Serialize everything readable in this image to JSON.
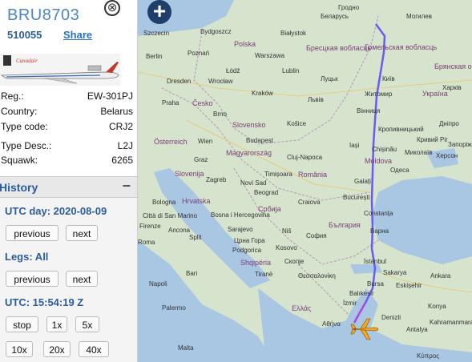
{
  "aircraft": {
    "callsign": "BRU8703",
    "hex": "510055",
    "share_label": "Share",
    "close_symbol": "⊗",
    "photo_text": "Canadair",
    "details": [
      {
        "label": "Reg.:",
        "value": "EW-301PJ"
      },
      {
        "label": "Country:",
        "value": "Belarus"
      },
      {
        "label": "Type code:",
        "value": "CRJ2"
      },
      {
        "label": "Type Desc.:",
        "value": "L2J"
      },
      {
        "label": "Squawk:",
        "value": "6265"
      }
    ]
  },
  "history": {
    "title": "History",
    "collapse_symbol": "−",
    "utc_day_label": "UTC day: 2020-08-09",
    "day_buttons": [
      "previous",
      "next"
    ],
    "legs_label": "Legs: All",
    "leg_buttons": [
      "previous",
      "next"
    ],
    "utc_time_label": "UTC: 15:54:19 Z",
    "speed_buttons_row1": [
      "stop",
      "1x",
      "5x"
    ],
    "speed_buttons_row2": [
      "10x",
      "20x",
      "40x"
    ]
  },
  "map": {
    "zoom_symbol": "+",
    "track_color": "#6a5cf0",
    "track_color_end": "#b04ae0",
    "aircraft_color": "#f5a623",
    "labels": {
      "belarus": "Беларусь",
      "mogilev": "Могилев",
      "bialystok": "Białystok",
      "grodno": "Гродно",
      "szczecin": "Szczecin",
      "bydgoszcz": "Bydgoszcz",
      "polska": "Polska",
      "warszawa": "Warszawa",
      "berlin": "Berlin",
      "poznan": "Poznań",
      "lodz": "Łódź",
      "lublin": "Lublin",
      "lutsk": "Луцьк",
      "kyiv": "Київ",
      "zhytomyr": "Житомир",
      "dresden": "Dresden",
      "wroclaw": "Wrocław",
      "praha": "Praha",
      "cesko": "Česko",
      "krakow": "Kraków",
      "lviv": "Львів",
      "vinnytsia": "Вінниця",
      "ukraina": "Україна",
      "kropyvnytskyi": "Кропивницький",
      "dnipro": "Дніпро",
      "kharkiv": "Харків",
      "zaporizhzhia": "Запоріжжя",
      "kryvyi_rih": "Кривий Ріг",
      "brno": "Brno",
      "slovensko": "Slovensko",
      "kosice": "Košice",
      "wien": "Wien",
      "osterreich": "Österreich",
      "budapest": "Budapest",
      "magyarorszag": "Magyarország",
      "chisinau": "Chișinău",
      "moldova": "Moldova",
      "odesa": "Одеса",
      "mykolaiv": "Миколаїв",
      "kherson": "Херсон",
      "cluj": "Cluj-Napoca",
      "romania": "România",
      "iasi": "Iași",
      "galati": "Galați",
      "graz": "Graz",
      "slovenija": "Slovenija",
      "zagreb": "Zagreb",
      "timisoara": "Timișoara",
      "novisad": "Novi Sad",
      "bucuresti": "București",
      "constanta": "Constanța",
      "beograd": "Beograd",
      "hrvatska": "Hrvatska",
      "bih": "Bosna i Hercegovina",
      "srbija": "Србија",
      "craiova": "Craiova",
      "bologna": "Bologna",
      "firenze": "Firenze",
      "sarajevo": "Sarajevo",
      "split": "Split",
      "nis": "Niš",
      "sofia": "София",
      "bulgaria": "България",
      "varna": "Варна",
      "crnagora": "Црна Гора",
      "podgorica": "Podgorica",
      "kosovo": "Kosovo",
      "shqiperia": "Shqipëria",
      "tirane": "Tiranë",
      "skopje": "Скопје",
      "roma": "Roma",
      "bari": "Bari",
      "napoli": "Napoli",
      "thessaloniki": "Θεσσαλονίκη",
      "istanbul": "İstanbul",
      "sakarya": "Sakarya",
      "ankara": "Ankara",
      "bursa": "Bursa",
      "eskisehir": "Eskişehir",
      "ellas": "Ελλάς",
      "izmir": "İzmir",
      "balikesir": "Balıkesir",
      "athina": "Αθήνα",
      "denizli": "Denizli",
      "antalya": "Antalya",
      "konya": "Konya",
      "kahramanmaras": "Kahramanmaraş",
      "palermo": "Palermo",
      "malta": "Malta",
      "kypros": "Κύπρος",
      "citta": "Città di San Marino",
      "ancona": "Ancona",
      "podstawa": "Бресцкая вобласць",
      "gomel": "Гомельская вобласць",
      "bryansk": "Брянская область"
    }
  }
}
